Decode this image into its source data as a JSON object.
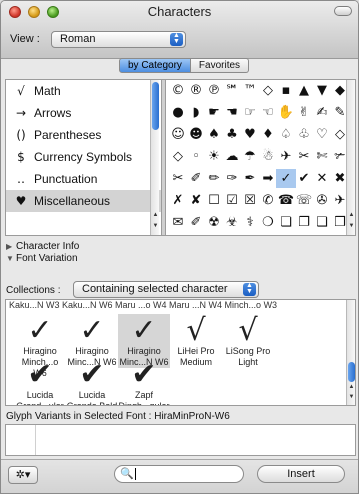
{
  "window": {
    "title": "Characters"
  },
  "toolbar": {
    "view_label": "View :",
    "view_value": "Roman"
  },
  "tabs": [
    {
      "label": "by Category",
      "selected": true
    },
    {
      "label": "Favorites",
      "selected": false
    }
  ],
  "categories": [
    {
      "glyph": "√",
      "label": "Math"
    },
    {
      "glyph": "→",
      "label": "Arrows"
    },
    {
      "glyph": "()",
      "label": "Parentheses"
    },
    {
      "glyph": "$",
      "label": "Currency Symbols"
    },
    {
      "glyph": "‥",
      "label": "Punctuation"
    },
    {
      "glyph": "♥",
      "label": "Miscellaneous",
      "selected": true
    }
  ],
  "glyph_rows": [
    [
      "©",
      "®",
      "℗",
      "℠",
      "™",
      "◇",
      "▪",
      "▲",
      "▼",
      "◆"
    ],
    [
      "●",
      "◗",
      "☛",
      "☚",
      "☞",
      "☜",
      "✋",
      "✌",
      "✍",
      "✎"
    ],
    [
      "☺",
      "☻",
      "♠",
      "♣",
      "♥",
      "♦",
      "♤",
      "♧",
      "♡",
      "◇"
    ],
    [
      "◇",
      "◦",
      "☀",
      "☁",
      "☂",
      "☃",
      "✈",
      "✂",
      "✄",
      "✃"
    ],
    [
      "✂",
      "✐",
      "✏",
      "✑",
      "✒",
      "➡",
      "✓",
      "✔",
      "✕",
      "✖"
    ],
    [
      "✗",
      "✘",
      "☐",
      "☑",
      "☒",
      "✆",
      "☎",
      "☏",
      "✇",
      "✈"
    ],
    [
      "✉",
      "✐",
      "☢",
      "☣",
      "⚕",
      "❍",
      "❏",
      "❐",
      "❑",
      "❒"
    ]
  ],
  "info": {
    "character_info": "Character Info",
    "font_variation": "Font Variation"
  },
  "collections": {
    "label": "Collections :",
    "value": "Containing selected character"
  },
  "font_header": "Kaku...N W3  Kaku...N W6  Maru ...o W4  Maru ...N W4  Minch...o W3",
  "font_variants": [
    {
      "char": "✓",
      "name": "Hiragino Minch...o W6"
    },
    {
      "char": "✓",
      "name": "Hiragino Minc...N W6"
    },
    {
      "char": "✓",
      "name": "Hiragino Minc...N W6",
      "selected": true
    },
    {
      "char": "√",
      "name": "LiHei Pro Medium"
    },
    {
      "char": "√",
      "name": "LiSong Pro Light"
    },
    {
      "char": "✔",
      "name": "Lucida Grand...ular"
    },
    {
      "char": "✔",
      "name": "Lucida Grande Bold"
    },
    {
      "char": "✔",
      "name": "Zapf Dingb...gular"
    }
  ],
  "glyph_variants_label": "Glyph Variants in Selected Font : HiraMinProN-W6",
  "bottom": {
    "gear_label": "✲▾",
    "search_value": "",
    "insert_label": "Insert"
  }
}
